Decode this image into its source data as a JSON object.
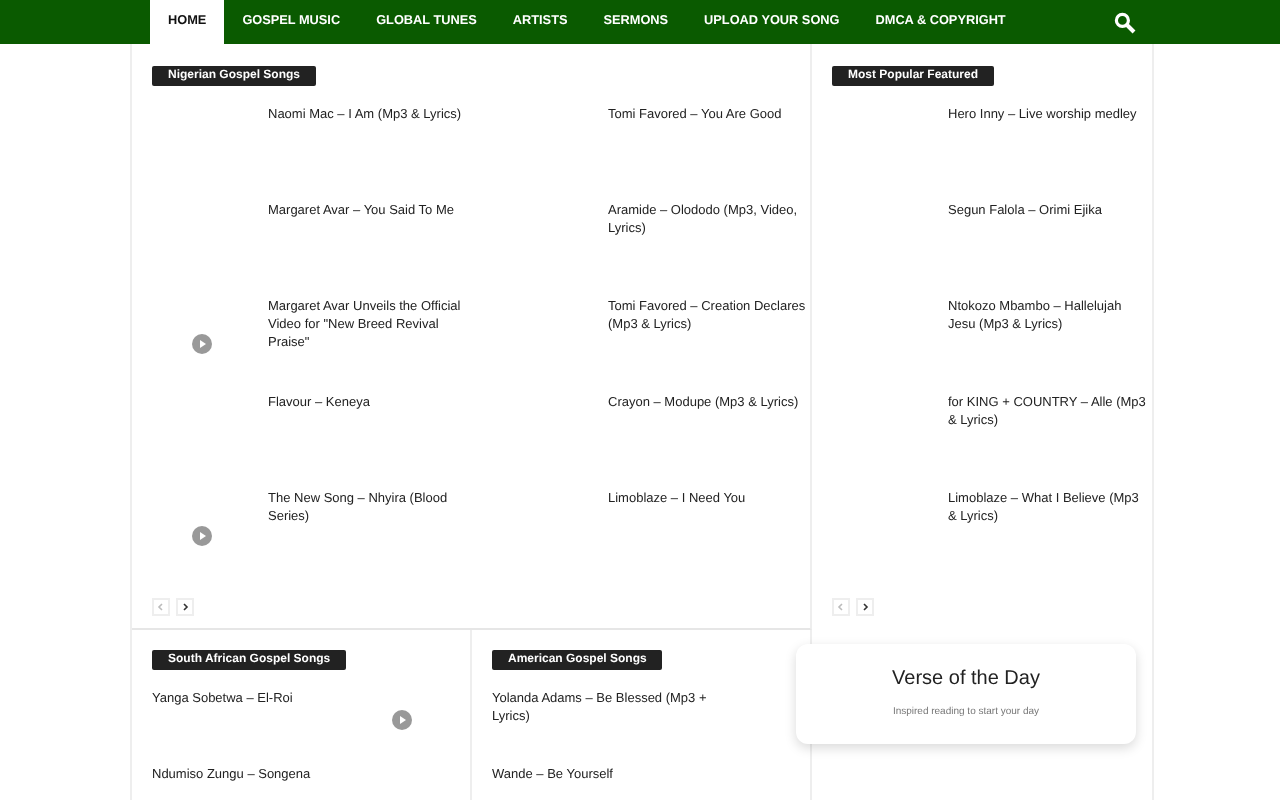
{
  "nav": {
    "items": [
      {
        "label": "HOME",
        "selected": true
      },
      {
        "label": "GOSPEL MUSIC",
        "selected": false
      },
      {
        "label": "GLOBAL TUNES",
        "selected": false
      },
      {
        "label": "ARTISTS",
        "selected": false
      },
      {
        "label": "SERMONS",
        "selected": false
      },
      {
        "label": "UPLOAD YOUR SONG",
        "selected": false
      },
      {
        "label": "DMCA & COPYRIGHT",
        "selected": false
      }
    ]
  },
  "nigerian": {
    "label": "Nigerian Gospel Songs",
    "posts": [
      {
        "title": "Naomi Mac – I Am (Mp3 & Lyrics)",
        "video": false
      },
      {
        "title": "Tomi Favored – You Are Good",
        "video": false
      },
      {
        "title": "Margaret Avar – You Said To Me",
        "video": false
      },
      {
        "title": "Aramide – Olododo (Mp3, Video, Lyrics)",
        "video": false
      },
      {
        "title": "Margaret Avar Unveils the Official Video for \"New Breed Revival Praise\"",
        "video": true
      },
      {
        "title": "Tomi Favored – Creation Declares (Mp3 & Lyrics)",
        "video": false
      },
      {
        "title": "Flavour – Keneya",
        "video": false
      },
      {
        "title": "Crayon – Modupe (Mp3 & Lyrics)",
        "video": false
      },
      {
        "title": "The New Song – Nhyira (Blood Series)",
        "video": true
      },
      {
        "title": "Limoblaze – I Need You",
        "video": false
      }
    ]
  },
  "popular": {
    "label": "Most Popular Featured",
    "posts": [
      {
        "title": "Hero Inny – Live worship medley",
        "video": false
      },
      {
        "title": "Segun Falola – Orimi Ejika",
        "video": false
      },
      {
        "title": "Ntokozo Mbambo – Hallelujah Jesu (Mp3 & Lyrics)",
        "video": false
      },
      {
        "title": "for KING + COUNTRY – Alle (Mp3 & Lyrics)",
        "video": false
      },
      {
        "title": "Limoblaze – What I Believe (Mp3 & Lyrics)",
        "video": false
      }
    ]
  },
  "south_african": {
    "label": "South African Gospel Songs",
    "posts": [
      {
        "title": "Yanga Sobetwa – El-Roi",
        "video": true
      },
      {
        "title": "Ndumiso Zungu – Songena",
        "video": false
      }
    ]
  },
  "american": {
    "label": "American Gospel Songs",
    "posts": [
      {
        "title": "Yolanda Adams – Be Blessed (Mp3 + Lyrics)",
        "video": false
      },
      {
        "title": "Wande – Be Yourself",
        "video": false
      }
    ]
  },
  "verse": {
    "title": "Verse of the Day",
    "subtitle": "Inspired reading to start your day"
  }
}
